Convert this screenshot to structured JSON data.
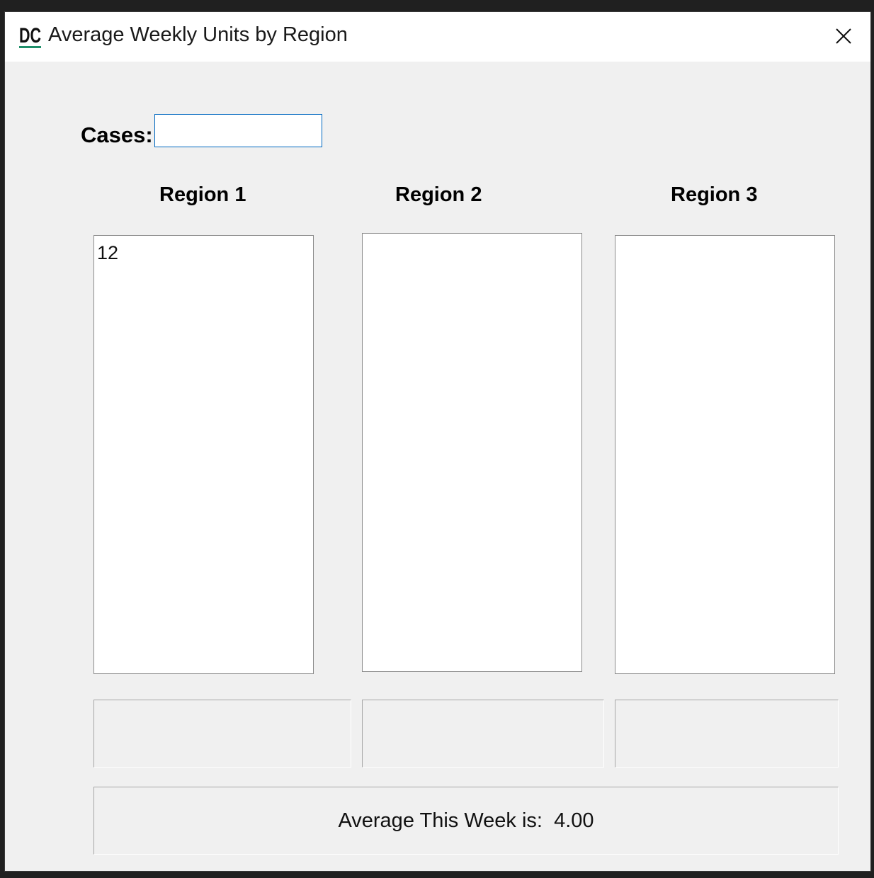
{
  "window": {
    "title": "Average Weekly Units by Region",
    "logo_text": "DC",
    "accent_color": "#1f8f6a"
  },
  "form": {
    "cases_label": "Cases:",
    "cases_value": ""
  },
  "regions": [
    {
      "heading": "Region 1",
      "items": [
        "12"
      ],
      "result": ""
    },
    {
      "heading": "Region 2",
      "items": [],
      "result": ""
    },
    {
      "heading": "Region 3",
      "items": [],
      "result": ""
    }
  ],
  "summary": {
    "average_text": "Average This Week is:  4.00"
  },
  "icons": {
    "close": "close-icon",
    "app": "app-logo-icon"
  }
}
